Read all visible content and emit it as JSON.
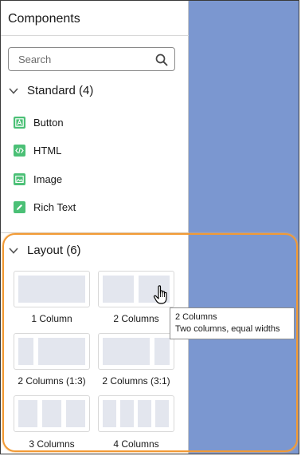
{
  "panel": {
    "title": "Components"
  },
  "search": {
    "placeholder": "Search"
  },
  "standard": {
    "header": "Standard (4)",
    "items": [
      {
        "label": "Button",
        "icon": "button-icon"
      },
      {
        "label": "HTML",
        "icon": "code-icon"
      },
      {
        "label": "Image",
        "icon": "image-icon"
      },
      {
        "label": "Rich Text",
        "icon": "pencil-icon"
      }
    ]
  },
  "layout": {
    "header": "Layout (6)",
    "items": [
      {
        "label": "1 Column"
      },
      {
        "label": "2 Columns"
      },
      {
        "label": "2 Columns (1:3)"
      },
      {
        "label": "2 Columns (3:1)"
      },
      {
        "label": "3 Columns"
      },
      {
        "label": "4 Columns"
      }
    ]
  },
  "tooltip": {
    "title": "2 Columns",
    "description": "Two columns, equal widths"
  },
  "colors": {
    "accent_green": "#4bc076",
    "highlight_orange": "#f29a34",
    "canvas_blue": "#7b97d0"
  }
}
